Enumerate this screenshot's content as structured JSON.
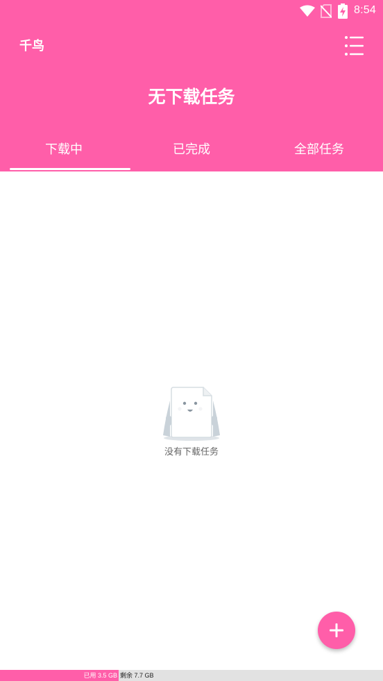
{
  "status_bar": {
    "time": "8:54",
    "icons": [
      "wifi-icon",
      "no-sim-icon",
      "battery-charging-icon"
    ]
  },
  "app": {
    "title": "千鸟",
    "menu_icon": "list-menu-icon"
  },
  "header": {
    "title": "无下载任务"
  },
  "tabs": [
    {
      "label": "下载中",
      "selected": true
    },
    {
      "label": "已完成",
      "selected": false
    },
    {
      "label": "全部任务",
      "selected": false
    }
  ],
  "empty_state": {
    "icon": "empty-document-icon",
    "message": "没有下载任务"
  },
  "fab": {
    "icon": "plus-icon"
  },
  "storage": {
    "used_label": "已用 3.5 GB",
    "free_label": "剩余 7.7 GB",
    "used_fraction": 0.31
  },
  "colors": {
    "accent": "#ff5ea9",
    "background": "#ffffff",
    "storage_track": "#e2e2e2"
  }
}
